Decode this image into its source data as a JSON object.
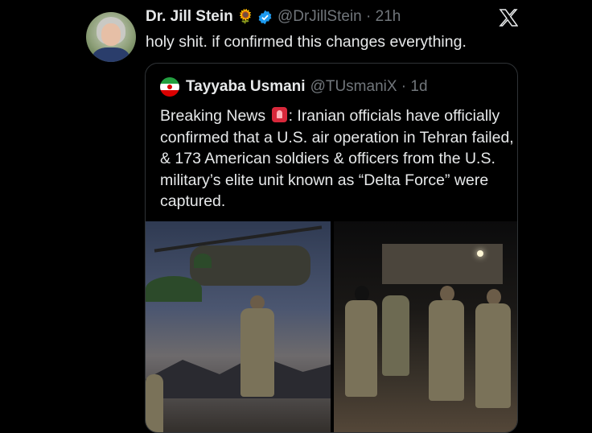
{
  "tweet": {
    "author_name": "Dr. Jill Stein",
    "author_emoji": "🌻",
    "handle_time": "@DrJillStein · 21h",
    "text": "holy shit. if confirmed this changes everything.",
    "logo": "x-logo-icon",
    "verified_color": "#1d9bf0"
  },
  "quote": {
    "author_name": "Tayyaba Usmani",
    "handle_time": "@TUsmaniX · 1d",
    "flag": "iran-flag-icon",
    "text_before_emoji": "Breaking News",
    "emoji": "siren-emoji-icon",
    "text_after_emoji": ": Iranian officials have officially confirmed that a U.S. air operation in Tehran failed, & 173 American soldiers & officers from the U.S. military’s elite unit known as “Delta Force” were captured."
  }
}
